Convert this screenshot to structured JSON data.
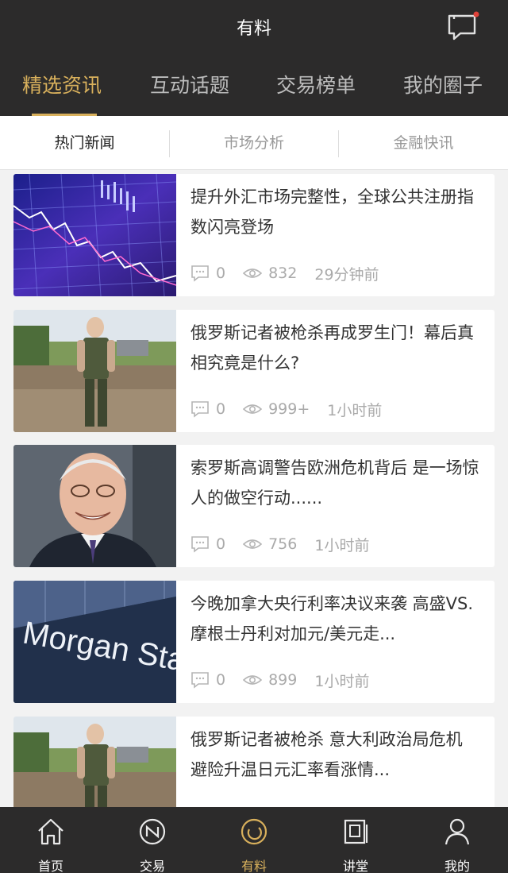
{
  "header": {
    "title": "有料"
  },
  "category_tabs": [
    "精选资讯",
    "互动话题",
    "交易榜单",
    "我的圈子"
  ],
  "sub_tabs": [
    "热门新闻",
    "市场分析",
    "金融快讯"
  ],
  "news": [
    {
      "headline": "提升外汇市场完整性，全球公共注册指数闪亮登场",
      "comments": "0",
      "views": "832",
      "time": "29分钟前",
      "thumb": "forex-chart"
    },
    {
      "headline": "俄罗斯记者被枪杀再成罗生门！幕后真相究竟是什么?",
      "comments": "0",
      "views": "999+",
      "time": "1小时前",
      "thumb": "soldier"
    },
    {
      "headline": "索罗斯高调警告欧洲危机背后 是一场惊人的做空行动......",
      "comments": "0",
      "views": "756",
      "time": "1小时前",
      "thumb": "portrait"
    },
    {
      "headline": "今晚加拿大央行利率决议来袭 高盛VS.摩根士丹利对加元/美元走...",
      "comments": "0",
      "views": "899",
      "time": "1小时前",
      "thumb": "morgan-stanley-sign",
      "thumb_text": "Morgan Stanle"
    },
    {
      "headline": "俄罗斯记者被枪杀 意大利政治局危机 避险升温日元汇率看涨情...",
      "comments": "",
      "views": "",
      "time": "",
      "thumb": "soldier"
    }
  ],
  "bottom_nav": [
    {
      "label": "首页",
      "icon": "home-icon"
    },
    {
      "label": "交易",
      "icon": "trade-icon"
    },
    {
      "label": "有料",
      "icon": "feed-icon"
    },
    {
      "label": "讲堂",
      "icon": "lecture-icon"
    },
    {
      "label": "我的",
      "icon": "profile-icon"
    }
  ],
  "colors": {
    "bar": "#2c2b2b",
    "accent": "#d8b05c",
    "text": "#333333",
    "meta": "#aaaaaa"
  }
}
